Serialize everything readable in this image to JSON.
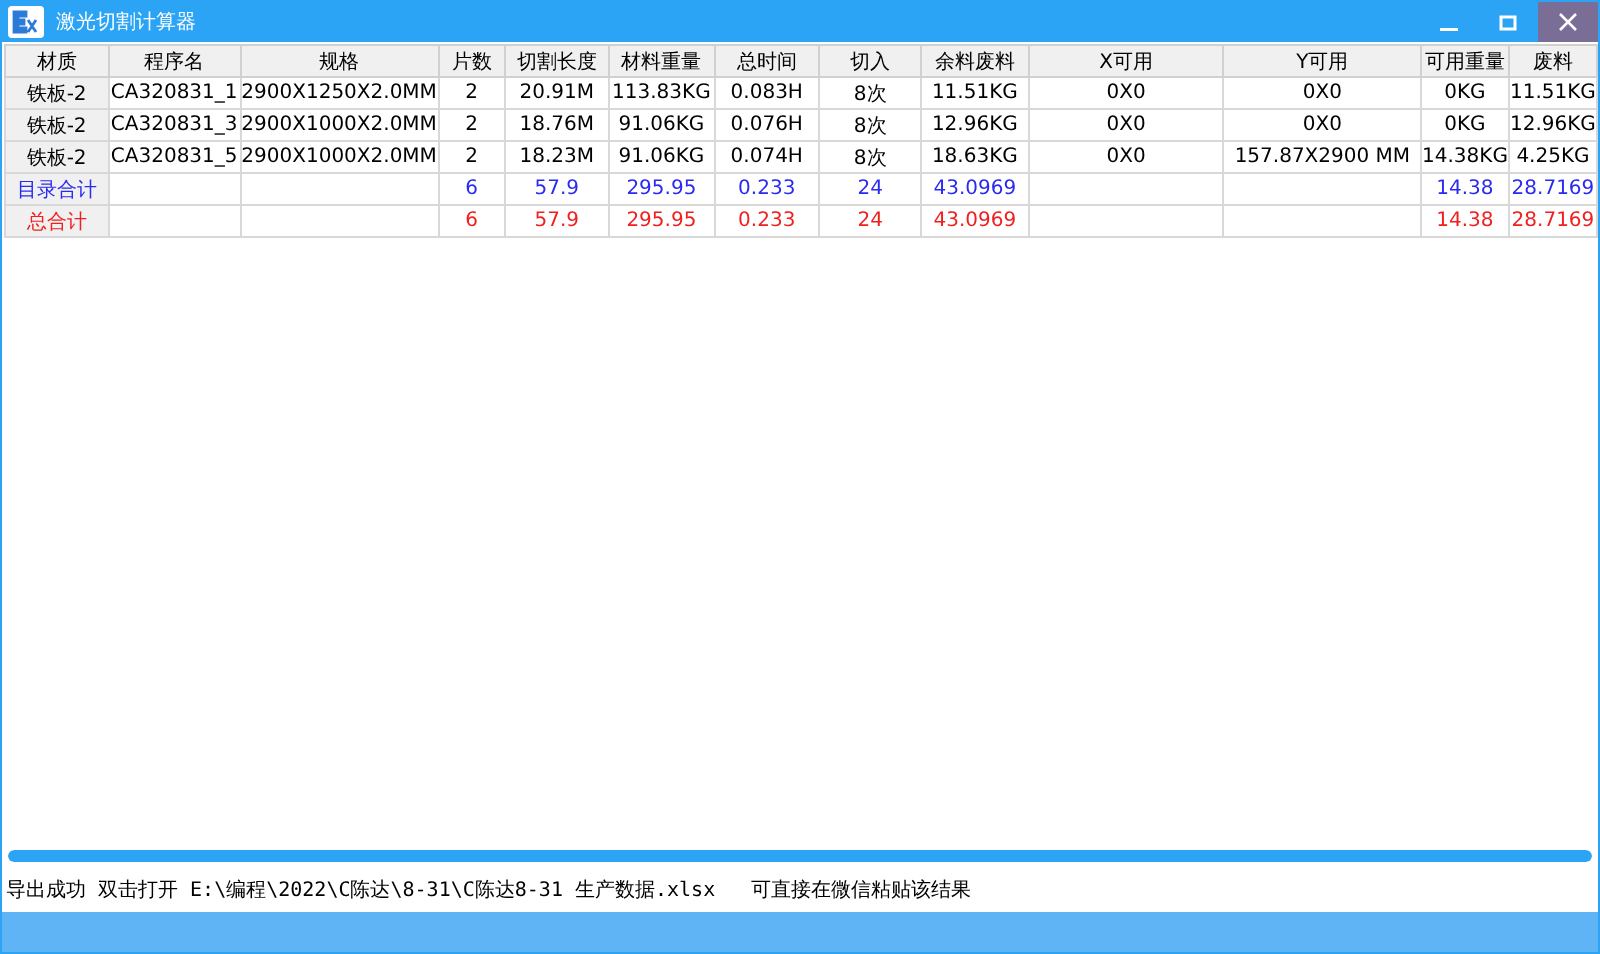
{
  "window": {
    "title": "激光切割计算器"
  },
  "table": {
    "columns": [
      "材质",
      "程序名",
      "规格",
      "片数",
      "切割长度",
      "材料重量",
      "总时间",
      "切入",
      "余料废料",
      "X可用",
      "Y可用",
      "可用重量",
      "废料"
    ],
    "rows": [
      {
        "kind": "item",
        "cells": [
          "铁板-2",
          "CA320831_1",
          "2900X1250X2.0MM",
          "2",
          "20.91M",
          "113.83KG",
          "0.083H",
          "8次",
          "11.51KG",
          "0X0",
          "0X0",
          "0KG",
          "11.51KG"
        ]
      },
      {
        "kind": "item",
        "cells": [
          "铁板-2",
          "CA320831_3",
          "2900X1000X2.0MM",
          "2",
          "18.76M",
          "91.06KG",
          "0.076H",
          "8次",
          "12.96KG",
          "0X0",
          "0X0",
          "0KG",
          "12.96KG"
        ]
      },
      {
        "kind": "item",
        "cells": [
          "铁板-2",
          "CA320831_5",
          "2900X1000X2.0MM",
          "2",
          "18.23M",
          "91.06KG",
          "0.074H",
          "8次",
          "18.63KG",
          "0X0",
          "157.87X2900 MM",
          "14.38KG",
          "4.25KG"
        ]
      },
      {
        "kind": "subtotal",
        "cells": [
          "目录合计",
          null,
          null,
          "6",
          "57.9",
          "295.95",
          "0.233",
          "24",
          "43.0969",
          null,
          null,
          "14.38",
          "28.7169"
        ]
      },
      {
        "kind": "total",
        "cells": [
          "总合计",
          null,
          null,
          "6",
          "57.9",
          "295.95",
          "0.233",
          "24",
          "43.0969",
          null,
          null,
          "14.38",
          "28.7169"
        ]
      }
    ]
  },
  "progress": {
    "level": 1
  },
  "status_bar": {
    "message": "导出成功 双击打开 E:\\编程\\2022\\C陈达\\8-31\\C陈达8-31 生产数据.xlsx",
    "hint": "可直接在微信粘贴该结果"
  }
}
